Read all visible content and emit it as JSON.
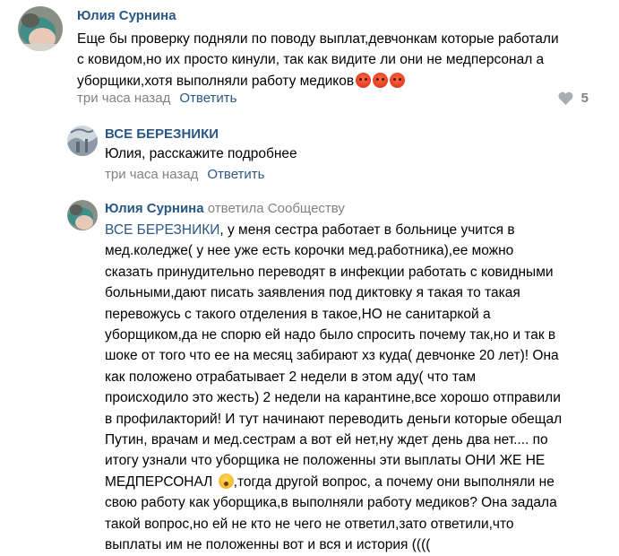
{
  "comments": [
    {
      "author": "Юлия Сурнина",
      "lines": [
        "Еще бы проверку подняли по поводу выплат,девчонкам которые работали",
        "с ковидом,но их просто кинули, так как видите ли они не медперсонал а",
        "уборщики,хотя выполняли работу медиков"
      ],
      "time": "три часа назад",
      "reply_label": "Ответить",
      "likes": "5"
    },
    {
      "author": "ВСЕ БЕРЕЗНИКИ",
      "lines": [
        "Юлия, расскажите подробнее"
      ],
      "time": "три часа назад",
      "reply_label": "Ответить"
    },
    {
      "author": "Юлия Сурнина",
      "action": "ответила Сообществу",
      "mention": "ВСЕ БЕРЕЗНИКИ",
      "first_line_rest": ", у меня сестра работает в больнице учится в",
      "lines": [
        "мед.коледже( у нее уже есть корочки мед.работника),ее можно",
        "сказать принудительно переводят в инфекции работать с ковидными",
        "больными,дают писать заявления под диктовку я такая то такая",
        "перевожусь с такого отделения в такое,НО не санитаркой а",
        "уборщиком,да не спорю ей надо было спросить почему так,но и так в",
        "шоке от того что ее на месяц забирают хз куда( девчонке 20 лет)! Она",
        "как положено отрабатывает 2 недели в этом аду( что там",
        "происходило это жесть) 2 недели на карантине,все хорошо отправили",
        "в профилакторий! И тут начинают переводить деньги которые обещал",
        "Путин, врачам и мед.сестрам а вот ей нет,ну ждет день два нет.... по",
        "итогу узнали что уборщика не положенны эти выплаты ОНИ ЖЕ НЕ"
      ],
      "line_13_start": "МЕДПЕРСОНАЛ",
      "line_13_end": ",тогда другой вопрос, а почему они выполняли не",
      "tail_lines": [
        "свою работу как уборщика,в выполняли работу медиков? Она задала",
        "такой вопрос,но ей не кто не чего не ответил,зато ответили,что",
        "выплаты им не положенны вот и вся и история (((("
      ]
    }
  ],
  "icons": {
    "angry": "angry-face-emoji",
    "shock": "astonished-face-emoji",
    "heart": "heart-icon"
  },
  "colors": {
    "link": "#2a5885",
    "muted": "#828282"
  }
}
